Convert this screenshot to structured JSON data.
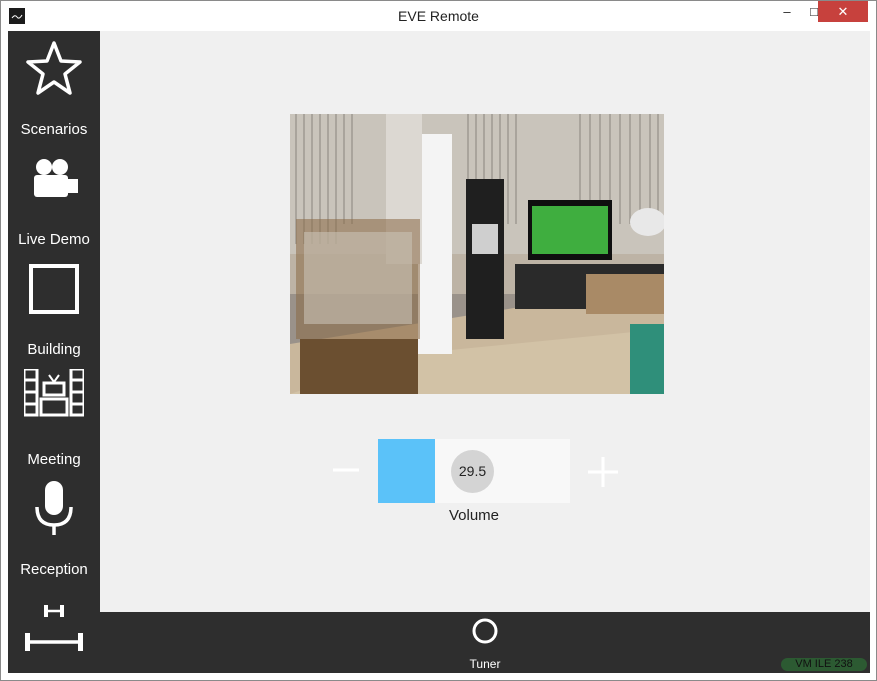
{
  "window": {
    "title": "EVE Remote",
    "minimize_label": "–",
    "maximize_label": "□",
    "close_label": "✕"
  },
  "sidebar": {
    "items": [
      {
        "label": "Scenarios",
        "icon": "star-icon"
      },
      {
        "label": "Live Demo",
        "icon": "video-camera-icon"
      },
      {
        "label": "Building",
        "icon": "square-icon"
      },
      {
        "label": "Meeting",
        "icon": "meeting-room-icon"
      },
      {
        "label": "Reception",
        "icon": "microphone-icon"
      },
      {
        "label": "",
        "icon": "dumbbell-icon"
      }
    ]
  },
  "main": {
    "camera_feed": {
      "icon": "camera-feed"
    },
    "volume": {
      "label": "Volume",
      "value": "29.5",
      "level_fraction": 0.295,
      "accent_color": "#5bc2f9"
    }
  },
  "bottom_bar": {
    "tuner_label": "Tuner",
    "status_badge": "VM ILE 238"
  }
}
